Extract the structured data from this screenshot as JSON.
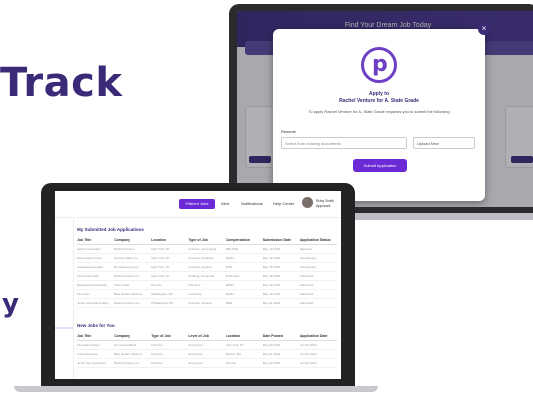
{
  "headline": "Track",
  "headline_tail": "y",
  "right_screen": {
    "topbar_title": "Find Your Dream Job Today",
    "modal": {
      "close_glyph": "×",
      "logo_letter": "p",
      "title_line1": "Apply to",
      "title_line2": "Rachel Venture for A. State Grade",
      "description": "To apply Rachel Venture for A. State Grade requests you to submit the following",
      "resume_label": "Resume",
      "resume_placeholder": "Select from existing documents",
      "upload_label": "Upload New",
      "submit_label": "Submit Application"
    }
  },
  "left_screen": {
    "header": {
      "pill_label": "Filtered Jobs",
      "nav_items": [
        "Alert",
        "Notifications",
        "Help Center"
      ],
      "user_name": "Ruby Smith",
      "user_role": "Applicant"
    },
    "submitted": {
      "title": "My Submitted Job Applications",
      "columns": [
        "Job Title",
        "Company",
        "Location",
        "Type of Job",
        "Compensation",
        "Submission Date",
        "Application Status"
      ],
      "rows": [
        [
          "Senior Consultant",
          "Rachel Venture",
          "New York, NY",
          "Full-time, Accounting",
          "$80-100k",
          "May 10 2023",
          "Rejected"
        ],
        [
          "Data Analyst Intern",
          "Northern Bliss Co.",
          "New York, NY",
          "Full-time, Analytics",
          "$20/hr",
          "May 12 2023",
          "Interviewing"
        ],
        [
          "Graduate Associate",
          "Brookstone Group",
          "New York, NY",
          "Full-time, Finance",
          "$75k",
          "May 15 2023",
          "Interviewing"
        ],
        [
          "Accounting Role",
          "Rachel Venture Co.",
          "New York, NY",
          "Auditing, Corporate",
          "$70k base",
          "May 16 2023",
          "Submitted"
        ],
        [
          "Bookkeeping Assistant",
          "Thermostat",
          "Remote",
          "Part-time",
          "$25/hr",
          "May 18 2023",
          "Submitted"
        ],
        [
          "Tax Intern",
          "Blue Harbor Advisors",
          "Washington, DC",
          "Internship",
          "$22/hr",
          "May 19 2023",
          "Submitted"
        ],
        [
          "Junior Financial Analyst",
          "Rachel Venture Co.",
          "Philadelphia, PA",
          "Full-time, Finance",
          "$68k",
          "May 21 2023",
          "Submitted"
        ]
      ]
    },
    "recommended": {
      "title": "New Jobs for You",
      "columns": [
        "Job Title",
        "Company",
        "Type of Job",
        "Level of Job",
        "Location",
        "Date Posted",
        "Application Date"
      ],
      "rows": [
        [
          "Financial Analyst",
          "Hometown Bank",
          "Full-time",
          "Entry level",
          "New York, NY",
          "May 20 2023",
          "Jun 20 2023"
        ],
        [
          "Audit Associate",
          "Blue Harbor Advisors",
          "Full-time",
          "Entry level",
          "Boston, MA",
          "May 21 2023",
          "Jun 21 2023"
        ],
        [
          "Junior Tax Consultant",
          "Rachel Venture Co.",
          "Full-time",
          "Entry level",
          "Remote",
          "May 22 2023",
          "Jun 22 2023"
        ]
      ]
    }
  }
}
